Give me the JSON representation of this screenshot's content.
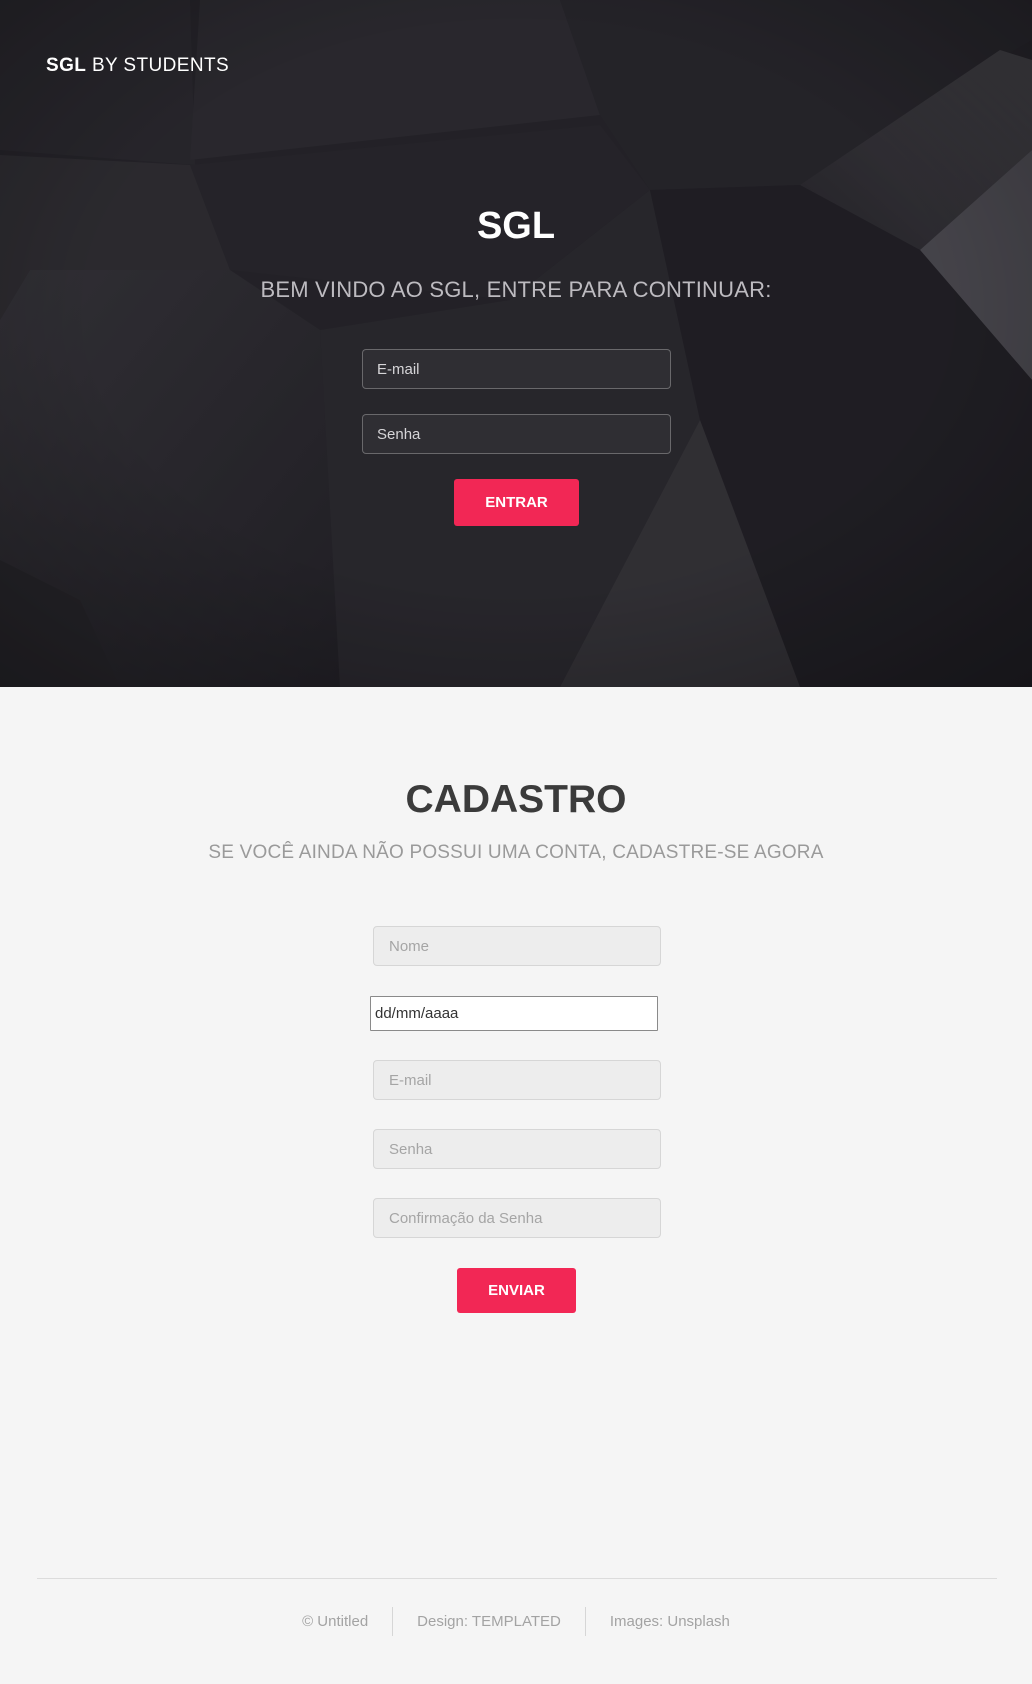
{
  "header": {
    "brand_bold": "SGL",
    "brand_rest": "BY STUDENTS"
  },
  "hero": {
    "title": "SGL",
    "subtitle": "BEM VINDO AO SGL, ENTRE PARA CONTINUAR:",
    "email_placeholder": "E-mail",
    "senha_placeholder": "Senha",
    "entrar_label": "ENTRAR"
  },
  "cadastro": {
    "title": "CADASTRO",
    "subtitle": "SE VOCÊ AINDA NÃO POSSUI UMA CONTA, CADASTRE-SE AGORA",
    "nome_placeholder": "Nome",
    "date_placeholder": "dd/mm/aaaa",
    "email_placeholder": "E-mail",
    "senha_placeholder": "Senha",
    "confirm_placeholder": "Confirmação da Senha",
    "enviar_label": "ENVIAR"
  },
  "footer": {
    "copyright": "© Untitled",
    "design": "Design: TEMPLATED",
    "images": "Images: Unsplash"
  },
  "colors": {
    "accent": "#f22755",
    "hero_bg": "#26242b",
    "page_bg": "#f5f5f5"
  }
}
